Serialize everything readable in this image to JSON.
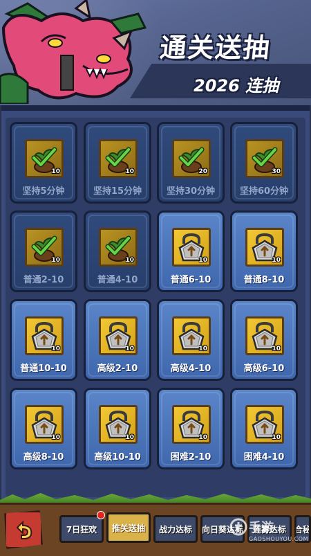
{
  "banner": {
    "title": "通关送抽",
    "subtitle": "2026 连抽"
  },
  "rewards": [
    {
      "label": "坚持5分钟",
      "count": "10",
      "state": "dark",
      "icon": "sprout-check-icon"
    },
    {
      "label": "坚持15分钟",
      "count": "10",
      "state": "dark",
      "icon": "sprout-check-icon"
    },
    {
      "label": "坚持30分钟",
      "count": "20",
      "state": "dark",
      "icon": "sprout-check-icon"
    },
    {
      "label": "坚持60分钟",
      "count": "30",
      "state": "dark",
      "icon": "sprout-check-icon"
    },
    {
      "label": "普通2-10",
      "count": "10",
      "state": "dark",
      "icon": "sprout-check-icon"
    },
    {
      "label": "普通4-10",
      "count": "10",
      "state": "dark",
      "icon": "sprout-check-icon"
    },
    {
      "label": "普通6-10",
      "count": "10",
      "state": "light",
      "icon": "padlock-icon"
    },
    {
      "label": "普通8-10",
      "count": "10",
      "state": "light",
      "icon": "padlock-icon"
    },
    {
      "label": "普通10-10",
      "count": "10",
      "state": "light",
      "icon": "padlock-icon"
    },
    {
      "label": "高级2-10",
      "count": "10",
      "state": "light",
      "icon": "padlock-icon"
    },
    {
      "label": "高级4-10",
      "count": "10",
      "state": "light",
      "icon": "padlock-icon"
    },
    {
      "label": "高级6-10",
      "count": "10",
      "state": "light",
      "icon": "padlock-icon"
    },
    {
      "label": "高级8-10",
      "count": "10",
      "state": "light",
      "icon": "padlock-icon"
    },
    {
      "label": "高级10-10",
      "count": "10",
      "state": "light",
      "icon": "padlock-icon"
    },
    {
      "label": "困难2-10",
      "count": "10",
      "state": "light",
      "icon": "padlock-icon"
    },
    {
      "label": "困难4-10",
      "count": "10",
      "state": "light",
      "icon": "padlock-icon"
    }
  ],
  "tabs": [
    {
      "label": "7日狂欢",
      "active": false,
      "badge": true
    },
    {
      "label": "推关送抽",
      "active": true,
      "badge": false
    },
    {
      "label": "战力达标",
      "active": false,
      "badge": false
    },
    {
      "label": "向日葵达标",
      "active": false,
      "badge": false
    },
    {
      "label": "莲雾达标",
      "active": false,
      "badge": false
    },
    {
      "label": "合秘",
      "active": false,
      "badge": false
    }
  ],
  "watermark": {
    "title": "手游",
    "url": "GAOSHOUYOU.COM"
  },
  "colors": {
    "accent": "#d9b24a",
    "back_button": "#c53a31",
    "badge": "#e3241b"
  }
}
